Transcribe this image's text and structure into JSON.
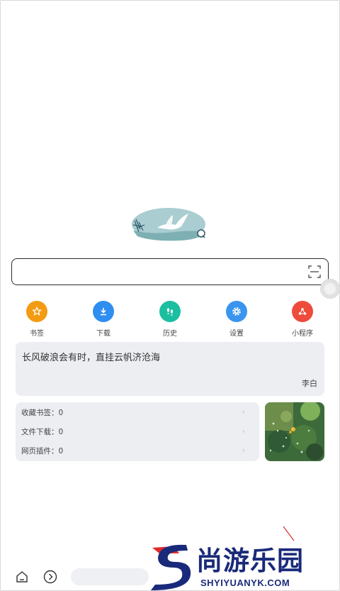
{
  "search": {
    "value": "",
    "placeholder": ""
  },
  "quick_actions": [
    {
      "label": "书签",
      "icon": "star-icon",
      "color": "#f39b12"
    },
    {
      "label": "下载",
      "icon": "download-icon",
      "color": "#2f8ef0"
    },
    {
      "label": "历史",
      "icon": "footprints-icon",
      "color": "#1bbfa0"
    },
    {
      "label": "设置",
      "icon": "gear-icon",
      "color": "#3a95ee"
    },
    {
      "label": "小程序",
      "icon": "mini-program-icon",
      "color": "#ee4b3c"
    }
  ],
  "quote": {
    "text": "长风破浪会有时，直挂云帆济沧海",
    "author": "李白"
  },
  "stats": [
    {
      "label": "收藏书签：0"
    },
    {
      "label": "文件下载：0"
    },
    {
      "label": "网页插件：0"
    }
  ],
  "watermark": {
    "cn": "尚游乐园",
    "en": "SHYIYUANYK.COM",
    "color": "#1a2a7a",
    "accent": "#e02a2a"
  }
}
